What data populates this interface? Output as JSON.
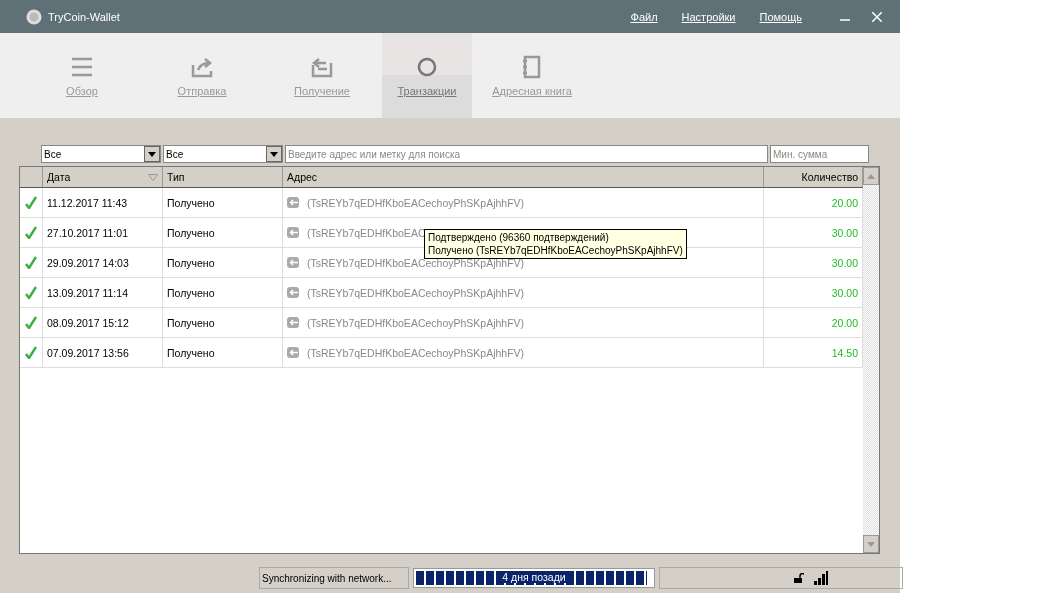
{
  "window": {
    "title": "TryCoin-Wallet"
  },
  "menu": [
    "Файл",
    "Настройки",
    "Помощь"
  ],
  "tabs": [
    {
      "label": "Обзор",
      "selected": false
    },
    {
      "label": "Отправка",
      "selected": false
    },
    {
      "label": "Получение",
      "selected": false
    },
    {
      "label": "Транзакции",
      "selected": true
    },
    {
      "label": "Адресная книга",
      "selected": false
    }
  ],
  "filters": {
    "date": "Все",
    "type": "Все",
    "search": {
      "placeholder": "Введите адрес или метку для поиска"
    },
    "min_amount": {
      "placeholder": "Мин. сумма"
    }
  },
  "table": {
    "columns": [
      "Дата",
      "Тип",
      "Адрес",
      "Количество"
    ],
    "rows": [
      {
        "confirmed": true,
        "date": "11.12.2017 11:43",
        "type": "Получено",
        "address": "(TsREYb7qEDHfKboEACechoyPhSKpAjhhFV)",
        "amount": "20.00"
      },
      {
        "confirmed": true,
        "date": "27.10.2017 11:01",
        "type": "Получено",
        "address": "(TsREYb7qEDHfKboEAC",
        "amount": "30.00"
      },
      {
        "confirmed": true,
        "date": "29.09.2017 14:03",
        "type": "Получено",
        "address": "(TsREYb7qEDHfKboEACechoyPhSKpAjhhFV)",
        "amount": "30.00"
      },
      {
        "confirmed": true,
        "date": "13.09.2017 11:14",
        "type": "Получено",
        "address": "(TsREYb7qEDHfKboEACechoyPhSKpAjhhFV)",
        "amount": "30.00"
      },
      {
        "confirmed": true,
        "date": "08.09.2017 15:12",
        "type": "Получено",
        "address": "(TsREYb7qEDHfKboEACechoyPhSKpAjhhFV)",
        "amount": "20.00"
      },
      {
        "confirmed": true,
        "date": "07.09.2017 13:56",
        "type": "Получено",
        "address": "(TsREYb7qEDHfKboEACechoyPhSKpAjhhFV)",
        "amount": "14.50"
      }
    ]
  },
  "tooltip": [
    "Подтверждено (96360 подтверждений)",
    "Получено (TsREYb7qEDHfKboEACechoyPhSKpAjhhFV)"
  ],
  "status_bar": {
    "message": "Synchronizing with network...",
    "progress": {
      "level": 0.98,
      "label": "4 дня позади"
    }
  }
}
